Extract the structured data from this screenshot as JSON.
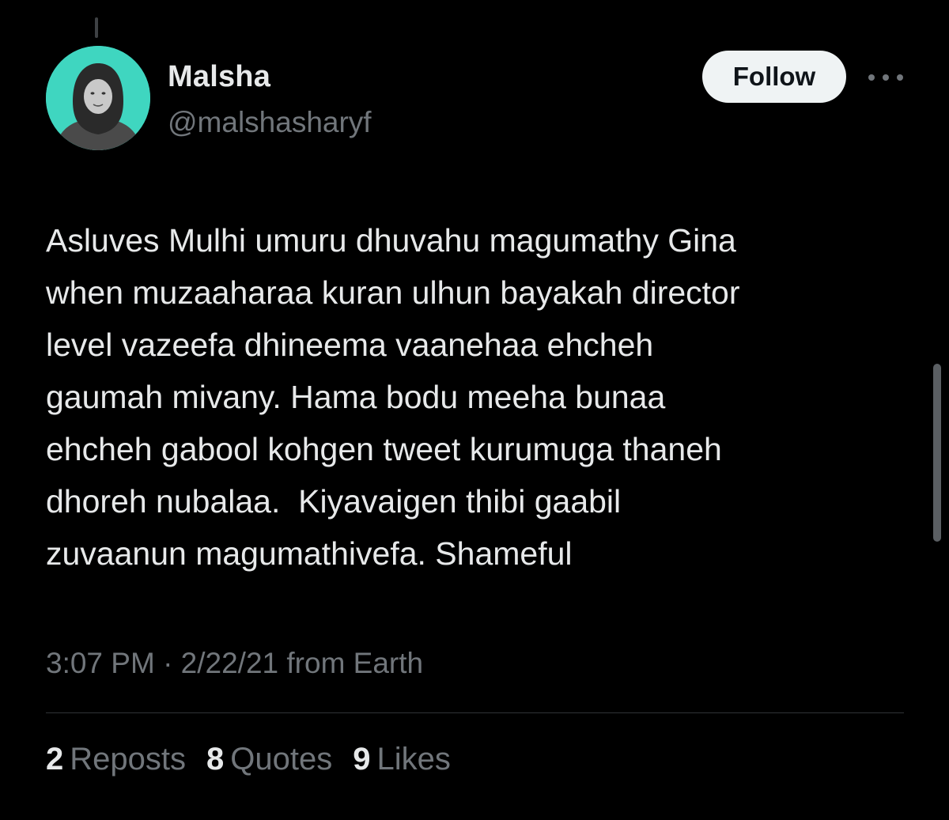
{
  "author": {
    "display_name": "Malsha",
    "handle": "@malshasharyf",
    "avatar_icon": "user-avatar-photo"
  },
  "follow_label": "Follow",
  "more_icon": "more-options-icon",
  "tweet": {
    "lines": [
      "Asluves Mulhi umuru dhuvahu magumathy Gina",
      "when muzaaharaa kuran ulhun bayakah director",
      "level vazeefa dhineema vaanehaa ehcheh",
      "gaumah mivany. Hama bodu meeha bunaa",
      "ehcheh gabool kohgen tweet kurumuga thaneh",
      "dhoreh nubalaa.  Kiyavaigen thibi gaabil",
      "zuvaanun magumathivefa. Shameful"
    ],
    "meta": "3:07 PM · 2/22/21 from Earth"
  },
  "stats": {
    "reposts_count": "2",
    "reposts_label": "Reposts",
    "quotes_count": "8",
    "quotes_label": "Quotes",
    "likes_count": "9",
    "likes_label": "Likes"
  },
  "colors": {
    "background": "#000000",
    "text_primary": "#e7e9ea",
    "text_secondary": "#71767b",
    "avatar_bg": "#3fd6c0",
    "follow_bg": "#eff3f4"
  }
}
